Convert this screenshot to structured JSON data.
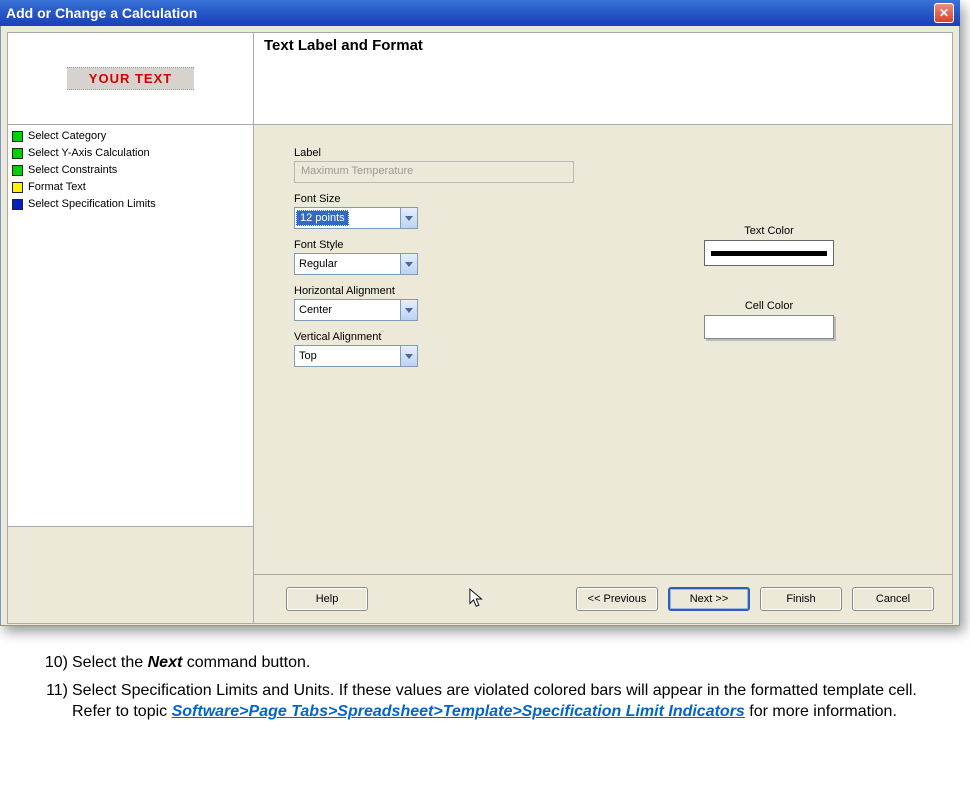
{
  "titlebar": {
    "title": "Add or Change a Calculation",
    "close": "✕"
  },
  "preview": {
    "text": "YOUR TEXT"
  },
  "steps": [
    {
      "color": "sw-green",
      "label": "Select Category"
    },
    {
      "color": "sw-green",
      "label": "Select Y-Axis Calculation"
    },
    {
      "color": "sw-green",
      "label": "Select Constraints"
    },
    {
      "color": "sw-yellow",
      "label": "Format Text"
    },
    {
      "color": "sw-blue",
      "label": "Select Specification Limits"
    }
  ],
  "panel_title": "Text Label and Format",
  "form": {
    "label_label": "Label",
    "label_value": "Maximum Temperature",
    "fontsize_label": "Font Size",
    "fontsize_value": "12 points",
    "fontstyle_label": "Font Style",
    "fontstyle_value": "Regular",
    "halign_label": "Horizontal Alignment",
    "halign_value": "Center",
    "valign_label": "Vertical Alignment",
    "valign_value": "Top",
    "textcolor_label": "Text Color",
    "cellcolor_label": "Cell Color"
  },
  "buttons": {
    "help": "Help",
    "prev": "<< Previous",
    "next": "Next >>",
    "finish": "Finish",
    "cancel": "Cancel"
  },
  "instructions": {
    "i10_num": "10)",
    "i10_a": "Select the ",
    "i10_b": "Next",
    "i10_c": " command button.",
    "i11_num": "11)",
    "i11_a": "Select Specification Limits and Units. If these values are violated colored bars will appear in the formatted template cell. Refer to   topic ",
    "i11_link": "Software>Page Tabs>Spreadsheet>Template>Specification Limit Indicators",
    "i11_b": " for more information."
  }
}
